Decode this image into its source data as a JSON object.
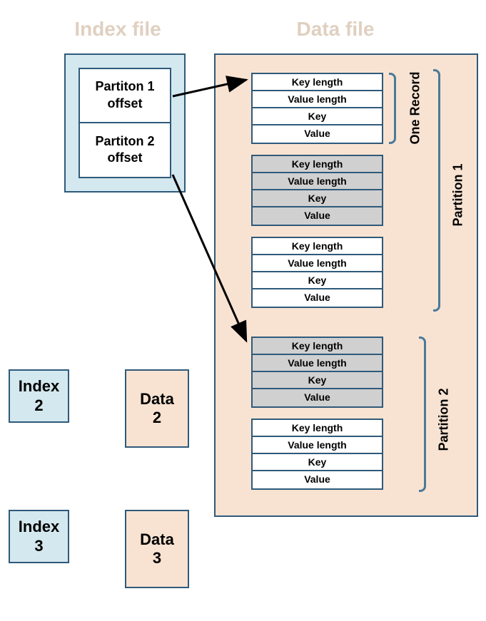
{
  "headers": {
    "index_file": "Index file",
    "data_file": "Data file"
  },
  "index_cells": {
    "p1_line1": "Partiton 1",
    "p1_line2": "offset",
    "p2_line1": "Partiton 2",
    "p2_line2": "offset"
  },
  "record_rows": {
    "r1": "Key length",
    "r2": "Value length",
    "r3": "Key",
    "r4": "Value"
  },
  "labels": {
    "one_record": "One Record",
    "partition1": "Partition 1",
    "partition2": "Partition 2"
  },
  "small_boxes": {
    "index2_l1": "Index",
    "index2_l2": "2",
    "data2_l1": "Data",
    "data2_l2": "2",
    "index3_l1": "Index",
    "index3_l2": "3",
    "data3_l1": "Data",
    "data3_l2": "3"
  }
}
